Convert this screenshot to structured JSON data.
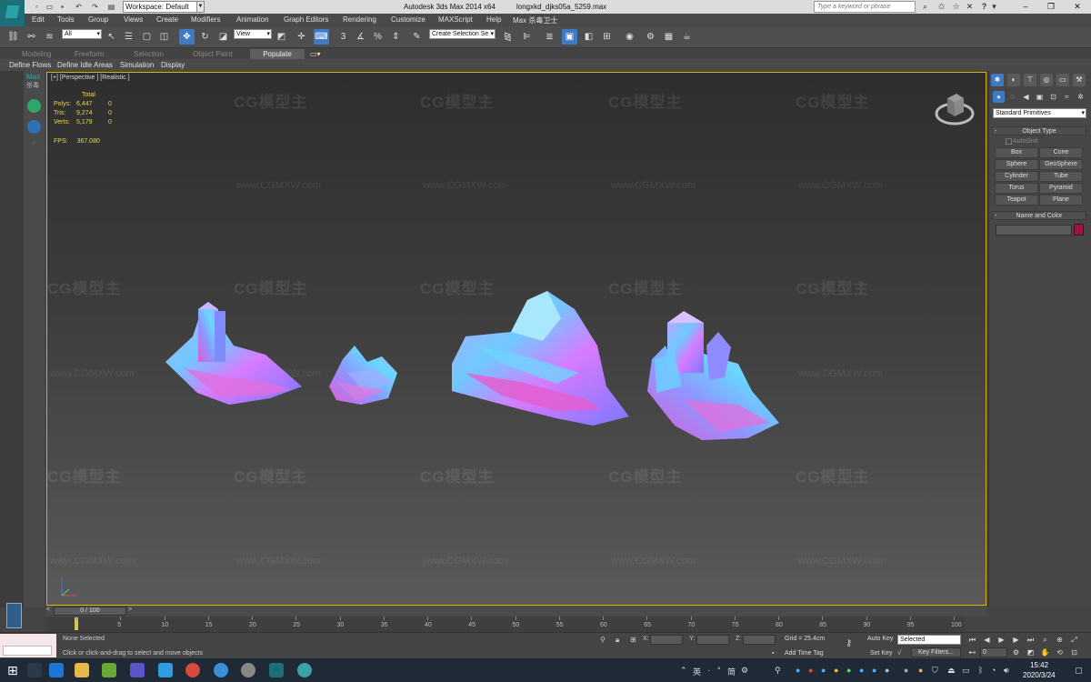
{
  "titlebar": {
    "workspace": "Workspace: Default",
    "app_title": "Autodesk 3ds Max  2014 x64",
    "file_title": "longxkd_djks05a_5259.max",
    "search_placeholder": "Type a keyword or phrase"
  },
  "menu": {
    "items": [
      "Edit",
      "Tools",
      "Group",
      "Views",
      "Create",
      "Modifiers",
      "Animation",
      "Graph Editors",
      "Rendering",
      "Customize",
      "MAXScript",
      "Help",
      "Max 杀毒卫士"
    ]
  },
  "toolbar": {
    "selection_filter": "All",
    "ref_coord": "View",
    "named_selection": "Create Selection Se"
  },
  "ribbon": {
    "tabs": [
      "Modeling",
      "Freeform",
      "Selection",
      "Object Paint",
      "Populate"
    ],
    "selected_tab": "Populate",
    "subtabs": [
      "Define Flows",
      "Define Idle Areas",
      "Simulation",
      "Display"
    ]
  },
  "leftstrip": {
    "title": "Max",
    "subtitle": "杀毒"
  },
  "viewport": {
    "label": "[+] [Perspective ] [Realistic ]",
    "stats_header": "Total",
    "stats": [
      {
        "label": "Polys:",
        "total": "6,447",
        "sel": "0"
      },
      {
        "label": "Tris:",
        "total": "9,274",
        "sel": "0"
      },
      {
        "label": "Verts:",
        "total": "5,179",
        "sel": "0"
      }
    ],
    "fps_label": "FPS:",
    "fps_value": "367.080",
    "watermark_logo": "CG模型主",
    "watermark_url": "www.CGMXW.com"
  },
  "command_panel": {
    "category": "Standard Primitives",
    "object_type_title": "Object Type",
    "autogrid": "AutoGrid",
    "primitives": [
      "Box",
      "Cone",
      "Sphere",
      "GeoSphere",
      "Cylinder",
      "Tube",
      "Torus",
      "Pyramid",
      "Teapot",
      "Plane"
    ],
    "name_color_title": "Name and Color",
    "object_color": "#9c1540"
  },
  "timeline": {
    "slider": "0 / 100",
    "ticks": [
      "0",
      "5",
      "10",
      "15",
      "20",
      "25",
      "30",
      "35",
      "40",
      "45",
      "50",
      "55",
      "60",
      "65",
      "70",
      "75",
      "80",
      "85",
      "90",
      "95",
      "100"
    ]
  },
  "status": {
    "selected": "None Selected",
    "prompt": "Click or click-and-drag to select and move objects",
    "x_label": "X:",
    "y_label": "Y:",
    "z_label": "Z:",
    "grid": "Grid = 25.4cm",
    "time_tag": "Add Time Tag",
    "auto_key": "Auto Key",
    "set_key": "Set Key",
    "selection_set": "Selected",
    "key_filters": "Key Filters...",
    "frame": "0"
  },
  "taskbar": {
    "ime": "英",
    "ime2": "简",
    "time": "15:42",
    "date": "2020/3/24"
  }
}
